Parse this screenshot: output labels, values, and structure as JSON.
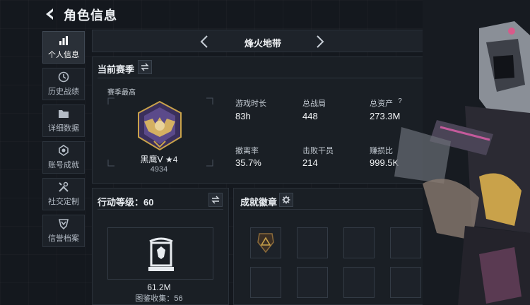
{
  "header": {
    "title": "角色信息"
  },
  "nav": {
    "items": [
      {
        "label": "个人信息",
        "icon": "bar-chart-icon",
        "active": true
      },
      {
        "label": "历史战绩",
        "icon": "clock-icon",
        "active": false
      },
      {
        "label": "详细数据",
        "icon": "folder-icon",
        "active": false
      },
      {
        "label": "账号成就",
        "icon": "achievement-icon",
        "active": false
      },
      {
        "label": "社交定制",
        "icon": "tools-icon",
        "active": false
      },
      {
        "label": "信誉档案",
        "icon": "shield-icon",
        "active": false
      }
    ]
  },
  "mode": {
    "name": "烽火地带"
  },
  "season": {
    "title": "当前赛季",
    "peak_label": "赛季最高",
    "rank_name": "黑鹰Ⅴ ★4",
    "rank_score": "4934",
    "stats": [
      {
        "label": "游戏时长",
        "value": "83h"
      },
      {
        "label": "总战局",
        "value": "448"
      },
      {
        "label": "总资产",
        "value": "273.3M",
        "help": "?"
      },
      {
        "label": "撤离率",
        "value": "35.7%"
      },
      {
        "label": "击败干员",
        "value": "214"
      },
      {
        "label": "赚损比",
        "value": "999.5K"
      }
    ]
  },
  "action_level": {
    "title": "行动等级：60",
    "collection_value": "61.2M",
    "collection_label": "图鉴收集：56"
  },
  "achievements": {
    "title": "成就徽章"
  },
  "colors": {
    "background": "#14181e",
    "panel": "#1a1f25",
    "accent_gold": "#c9a24a",
    "rank_purple": "#5b4a8a"
  }
}
